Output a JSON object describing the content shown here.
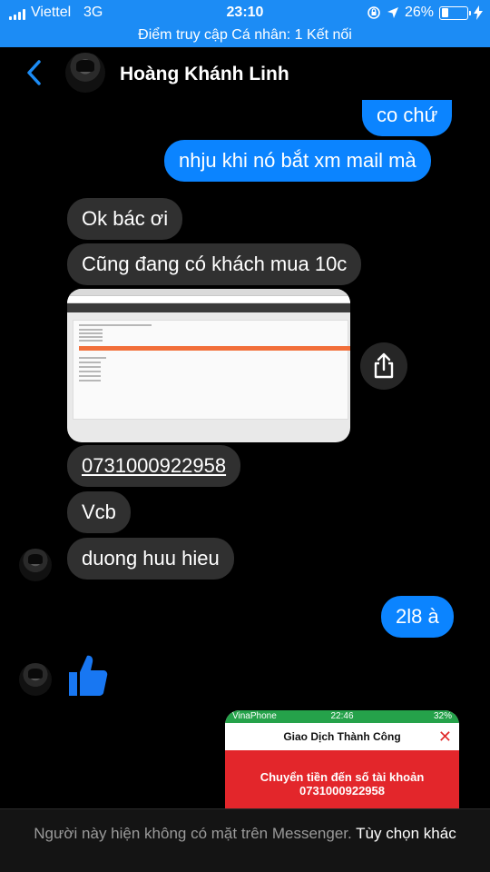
{
  "status_bar": {
    "carrier": "Viettel",
    "network": "3G",
    "time": "23:10",
    "battery": "26%",
    "battery_level": 0.26,
    "hotspot_text": "Điểm truy cập Cá nhân: 1 Kết nối"
  },
  "header": {
    "contact_name": "Hoàng Khánh Linh"
  },
  "messages": {
    "out_1": "co chứ",
    "out_2": "nhju khi nó bắt xm mail mà",
    "in_1": "Ok bác ơi",
    "in_2": "Cũng đang có khách mua 10c",
    "in_3": "0731000922958",
    "in_4": "Vcb",
    "in_5": "duong huu hieu",
    "out_3": "2l8 à"
  },
  "receipt": {
    "carrier": "VinaPhone",
    "time": "22:46",
    "battery": "32%",
    "title": "Giao Dịch Thành Công",
    "line1": "Chuyển tiền đến số tài khoản",
    "account": "0731000922958"
  },
  "footer": {
    "notice": "Người này hiện không có mặt trên Messenger.",
    "link": "Tùy chọn khác"
  },
  "colors": {
    "accent": "#1c8cf5",
    "outgoing_bubble": "#0b84ff",
    "incoming_bubble": "#303030",
    "background": "#000000"
  },
  "icons": {
    "back": "chevron-left-icon",
    "share": "share-icon",
    "like": "thumbs-up-icon"
  }
}
